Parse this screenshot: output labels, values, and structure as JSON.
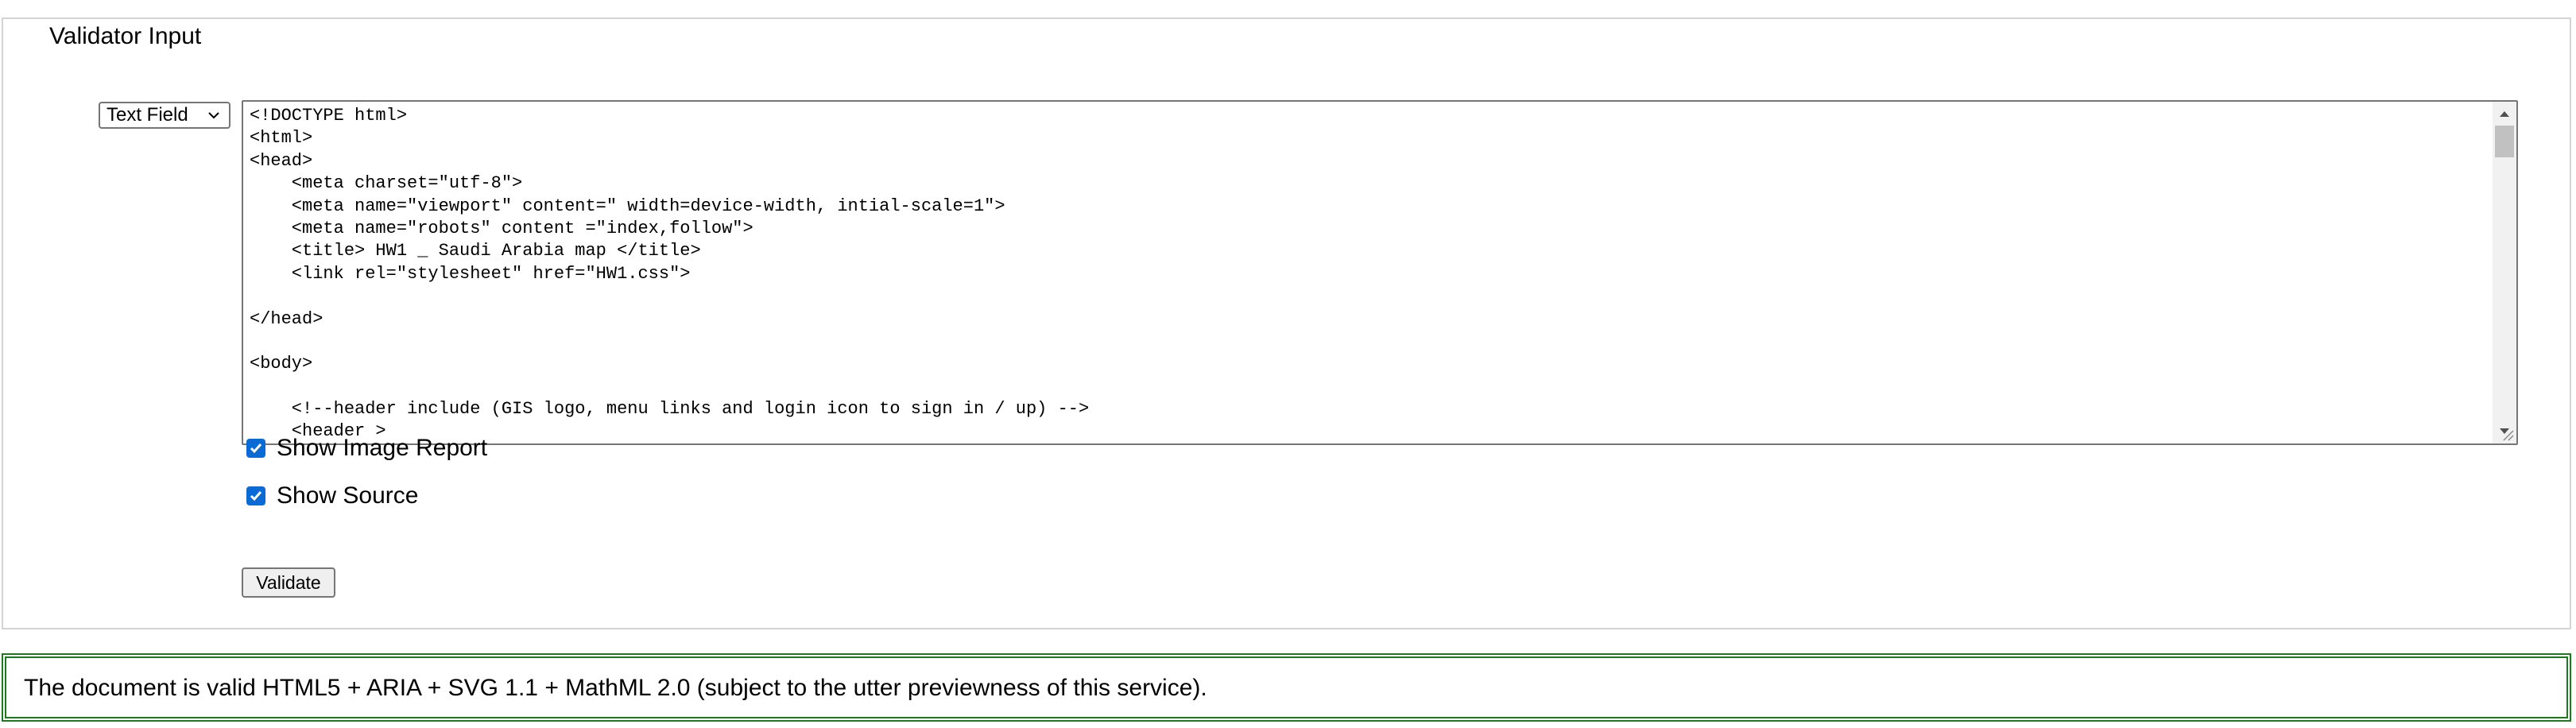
{
  "fieldset": {
    "legend": "Validator Input"
  },
  "input_mode": {
    "selected": "Text Field"
  },
  "source_code": {
    "lines": [
      "<!DOCTYPE html>",
      "<html>",
      "<head>",
      "    <meta charset=\"utf-8\">",
      "    <meta name=\"viewport\" content=\" width=device-width, intial-scale=1\">",
      "    <meta name=\"robots\" content =\"index,follow\">",
      "    <title> HW1 _ Saudi Arabia map </title>",
      "    <link rel=\"stylesheet\" href=\"HW1.css\">",
      "",
      "</head>",
      "",
      "<body>",
      "",
      "    <!--header include (GIS logo, menu links and login icon to sign in / up) -->",
      "    <header >"
    ]
  },
  "options": {
    "show_image_report": {
      "label": "Show Image Report",
      "checked": true
    },
    "show_source": {
      "label": "Show Source",
      "checked": true
    }
  },
  "validate_button": {
    "label": "Validate"
  },
  "result": {
    "message": "The document is valid HTML5 + ARIA + SVG 1.1 + MathML 2.0 (subject to the utter previewness of this service)."
  },
  "colors": {
    "checkbox_accent": "#0b6bd6",
    "success_border": "#1b7a1b",
    "fieldset_border": "#d4d4d4"
  }
}
